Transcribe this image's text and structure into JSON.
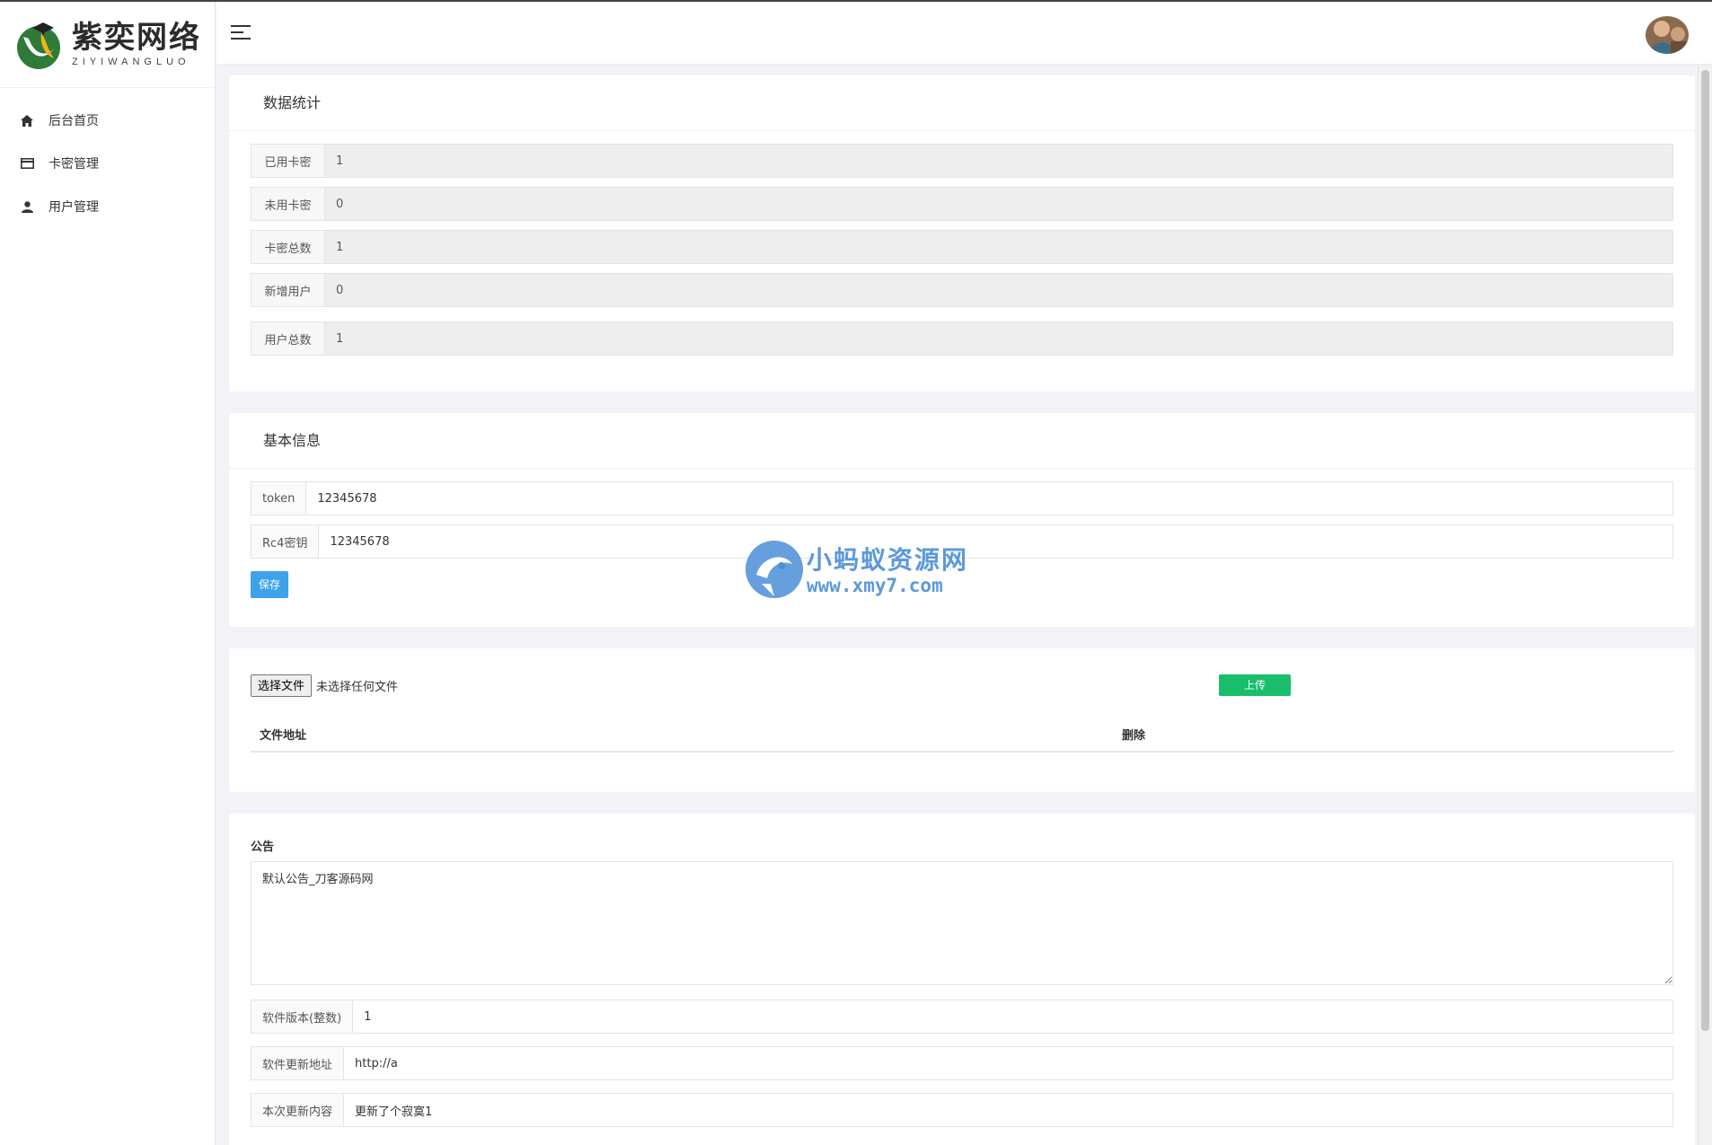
{
  "logo": {
    "cn": "紫奕网络",
    "en": "ZIYIWANGLUO"
  },
  "sidebar": {
    "items": [
      {
        "label": "后台首页",
        "icon": "home-icon"
      },
      {
        "label": "卡密管理",
        "icon": "card-icon"
      },
      {
        "label": "用户管理",
        "icon": "user-icon"
      }
    ]
  },
  "stats": {
    "title": "数据统计",
    "rows": [
      {
        "label": "已用卡密",
        "value": "1"
      },
      {
        "label": "未用卡密",
        "value": "0"
      },
      {
        "label": "卡密总数",
        "value": "1"
      },
      {
        "label": "新增用户",
        "value": "0"
      },
      {
        "label": "用户总数",
        "value": "1"
      }
    ]
  },
  "basic": {
    "title": "基本信息",
    "token_label": "token",
    "token_value": "12345678",
    "rc4_label": "Rc4密钥",
    "rc4_value": "12345678",
    "save_label": "保存"
  },
  "upload": {
    "choose_label": "选择文件",
    "no_file": "未选择任何文件",
    "upload_label": "上传",
    "col_path": "文件地址",
    "col_delete": "删除"
  },
  "notice": {
    "label": "公告",
    "content": "默认公告_刀客源码网",
    "version_label": "软件版本(整数)",
    "version_value": "1",
    "update_url_label": "软件更新地址",
    "update_url_value": "http://a",
    "update_content_label": "本次更新内容",
    "update_content_value": "更新了个寂寞1"
  },
  "watermark": {
    "cn": "小蚂蚁资源网",
    "en": "www.xmy7.com"
  },
  "colors": {
    "accent_blue": "#3ea2ea",
    "accent_green": "#19be6b"
  }
}
